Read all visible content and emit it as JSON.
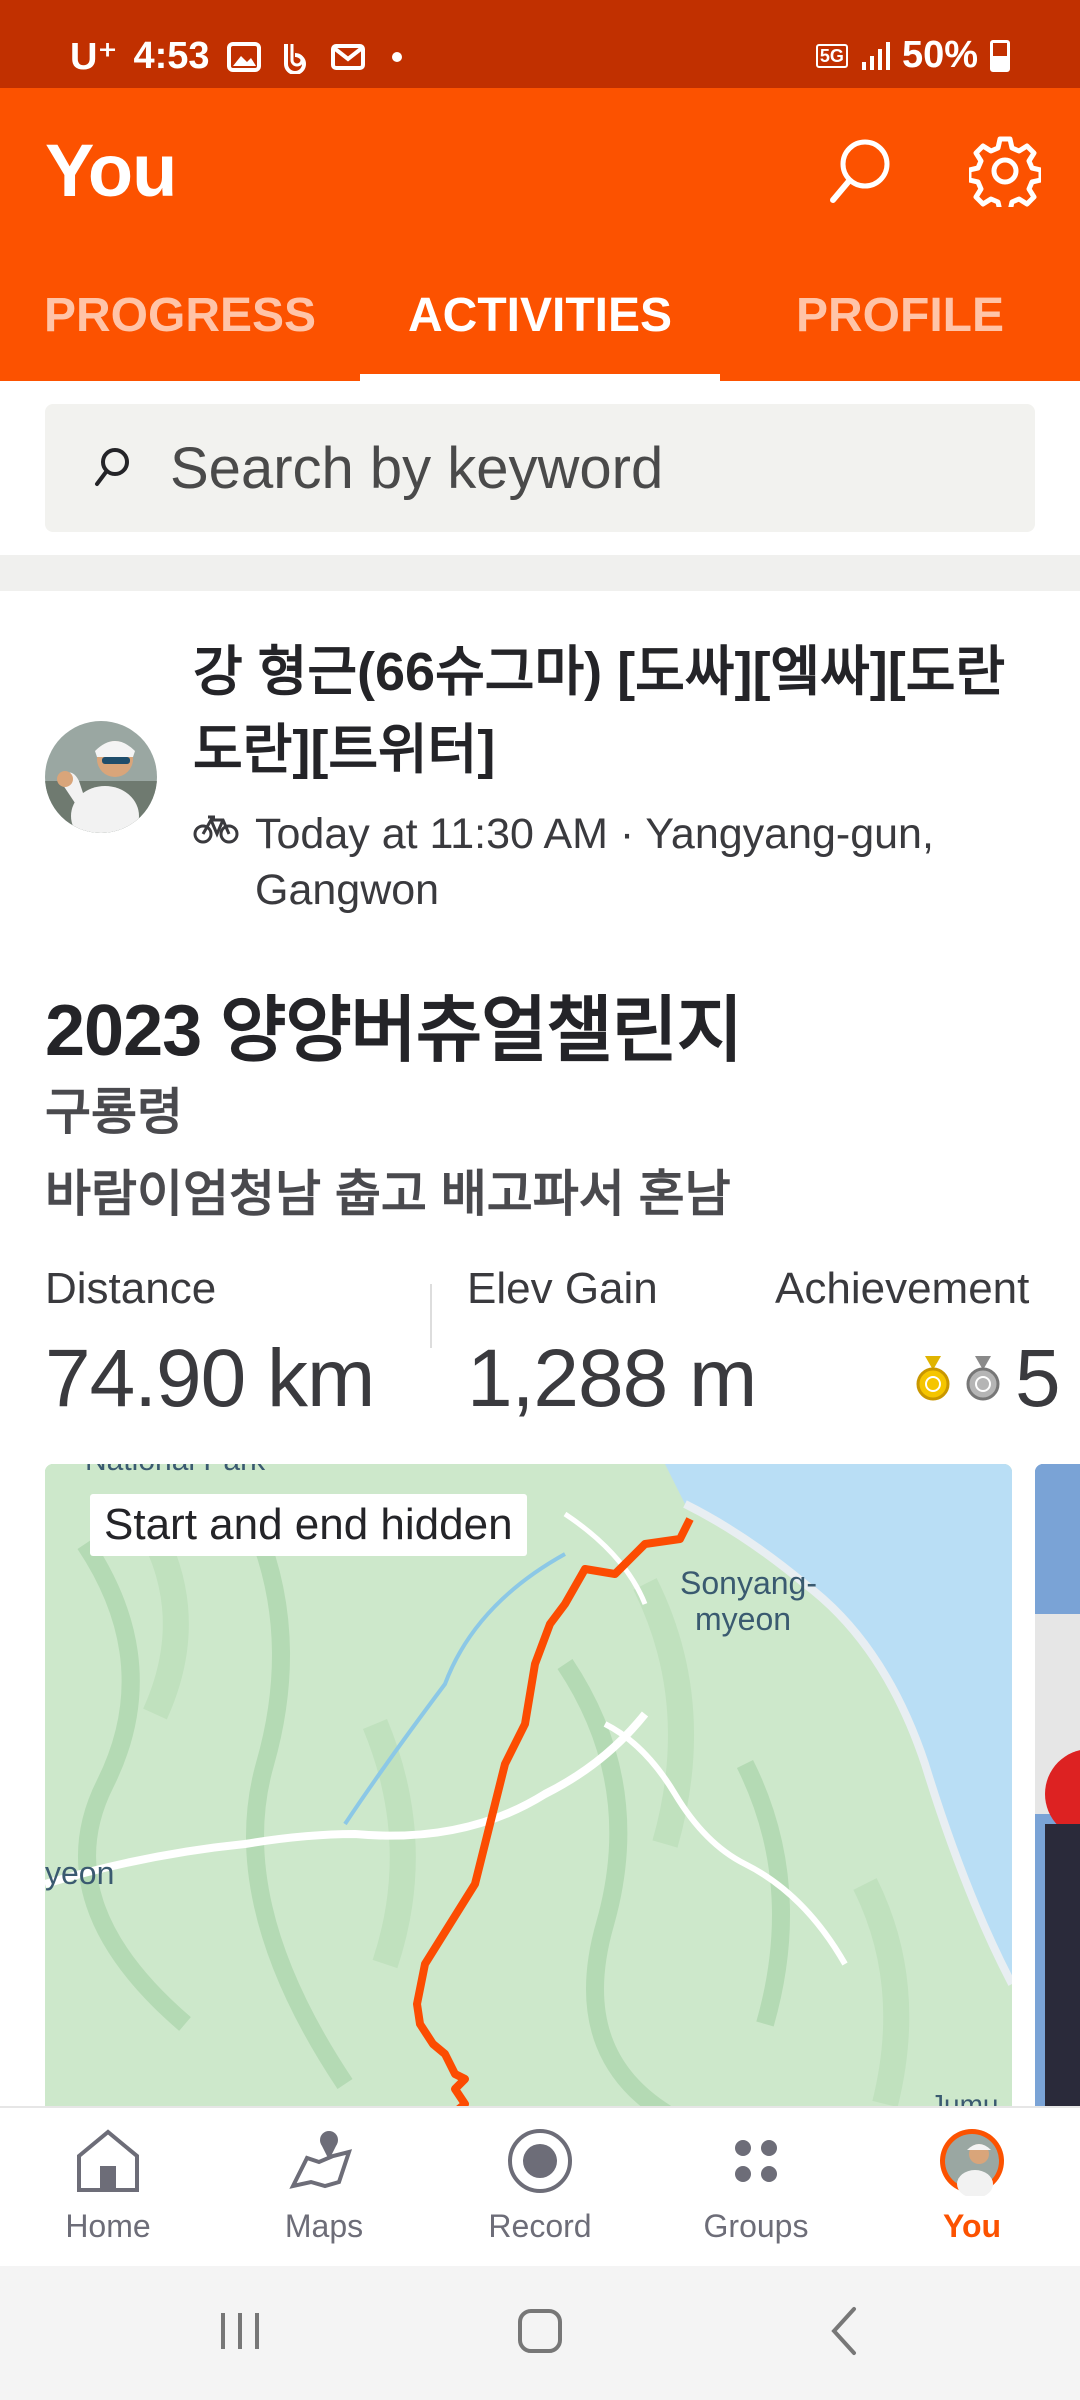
{
  "status_bar": {
    "carrier": "U⁺",
    "time": "4:53",
    "battery": "50%",
    "network": "5G"
  },
  "header": {
    "title": "You",
    "tabs": [
      {
        "label": "PROGRESS",
        "active": false
      },
      {
        "label": "ACTIVITIES",
        "active": true
      },
      {
        "label": "PROFILE",
        "active": false
      }
    ]
  },
  "search": {
    "placeholder": "Search by keyword"
  },
  "activity": {
    "athlete_name": "강 형근(66슈그마)  [도싸][엨싸][도란도란][트위터]",
    "meta": "Today at 11:30 AM · Yangyang-gun, Gangwon",
    "title": "2023 양양버츄얼챌린지",
    "description_line1": "구룡령",
    "description_line2": "바람이엄청남 춥고 배고파서 혼남",
    "stats": {
      "distance_label": "Distance",
      "distance_value": "74.90 km",
      "elev_label": "Elev Gain",
      "elev_value": "1,288 m",
      "achievement_label": "Achievement",
      "achievement_value": "5"
    },
    "map": {
      "overlay": "Start and end hidden",
      "place_labels": [
        "Sonyang-",
        "myeon",
        "yeon",
        "National Park",
        "Jumu"
      ]
    }
  },
  "bottom_nav": {
    "items": [
      {
        "label": "Home",
        "icon": "home-icon"
      },
      {
        "label": "Maps",
        "icon": "maps-icon"
      },
      {
        "label": "Record",
        "icon": "record-icon"
      },
      {
        "label": "Groups",
        "icon": "groups-icon"
      },
      {
        "label": "You",
        "icon": "avatar-icon",
        "active": true
      }
    ]
  },
  "colors": {
    "brand": "#fc5200",
    "status_bar": "#c13000",
    "route": "#fc4c02"
  }
}
